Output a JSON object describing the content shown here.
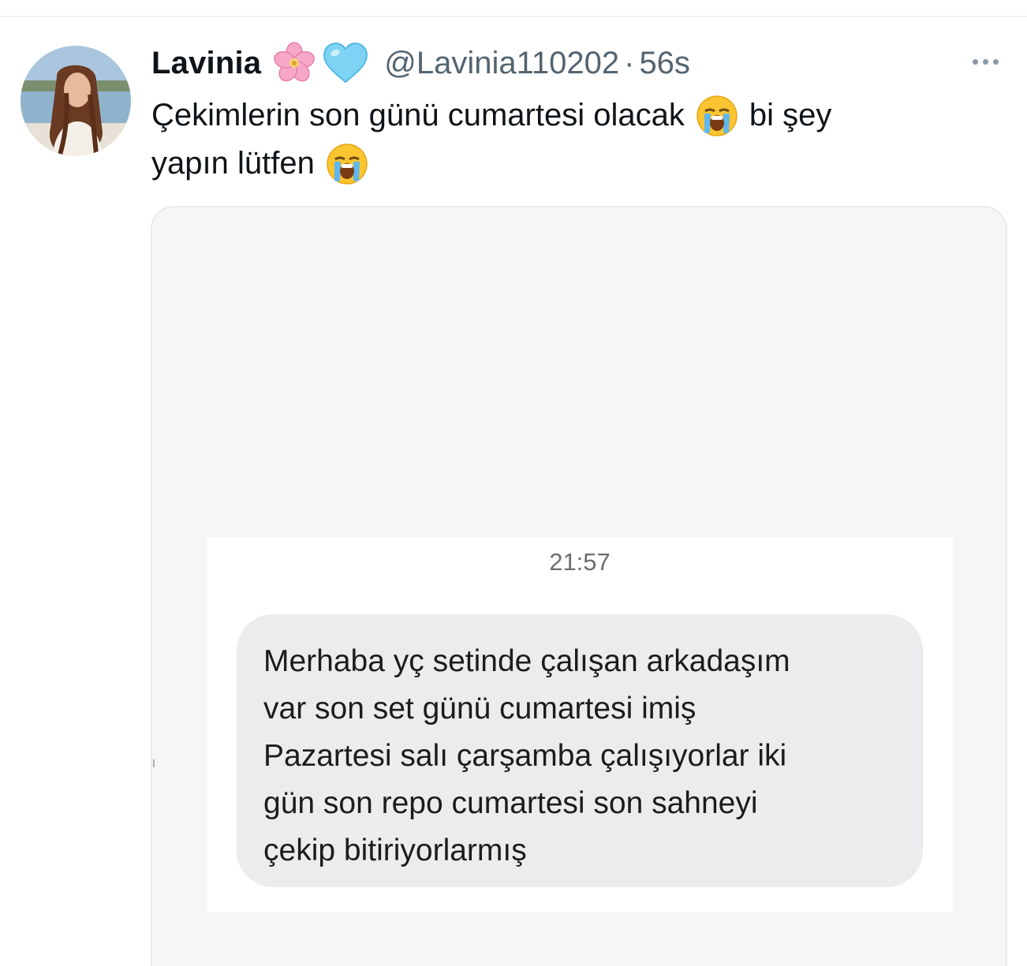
{
  "tweet": {
    "display_name": "Lavinia",
    "name_emojis": [
      "cherry-blossom-icon",
      "light-blue-heart-icon"
    ],
    "handle": "@Lavinia110202",
    "separator": "·",
    "time": "56s",
    "text_lines": [
      "Çekimlerin son günü cumartesi olacak",
      "bi şey",
      "yapın lütfen"
    ],
    "text_emoji": "loudly-crying-face-icon"
  },
  "media": {
    "chat_time": "21:57",
    "message_lines": [
      "Merhaba yç setinde çalışan arkadaşım",
      "var son set günü cumartesi imiş",
      "Pazartesi salı çarşamba çalışıyorlar iki",
      "gün son repo cumartesi son sahneyi",
      "çekip bitiriyorlarmış"
    ]
  },
  "colors": {
    "text_primary": "#0f1419",
    "text_secondary": "#536471",
    "bubble_bg": "#ececee",
    "media_bg": "#f6f6f7"
  }
}
